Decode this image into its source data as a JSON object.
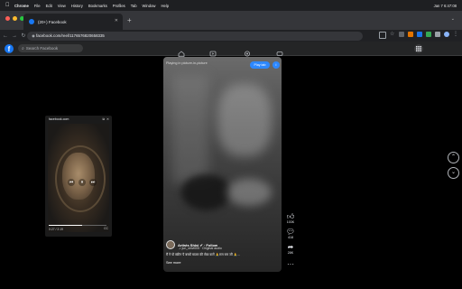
{
  "menubar": {
    "app": "Chrome",
    "items": [
      "File",
      "Edit",
      "View",
      "History",
      "Bookmarks",
      "Profiles",
      "Tab",
      "Window",
      "Help"
    ],
    "clock": "Jan 7  6:47:08"
  },
  "browser": {
    "tab_title": "(20+) Facebook",
    "url": "facebook.com/reel/1176576820658335",
    "colors": {
      "close": "#ff5f57",
      "minimize": "#febc2e",
      "zoom": "#28c840"
    }
  },
  "facebook": {
    "logo": "f",
    "search_placeholder": "Search Facebook",
    "nav_icons": [
      "home-icon",
      "video-icon",
      "marketplace-icon",
      "gaming-icon"
    ],
    "accent": "#1877f2"
  },
  "pip": {
    "title": "facebook.com",
    "time": "0:27 / 2:19",
    "cc": "CC",
    "progress": 0.58
  },
  "reel": {
    "pip_notice": "Playing in picture-in-picture",
    "play_tab_label": "Play tab",
    "author": "Artists Shivi ✔ · Follow",
    "audio": "♫ jun_shivi005 · Original audio",
    "caption": "मैं ने पो स्क्रीन पै बच्चों मातरा की सेवा करों 🙏राम राम जी 🙏...",
    "see_more": "See more",
    "likes": "103K",
    "comments": "418",
    "shares": "28K"
  }
}
